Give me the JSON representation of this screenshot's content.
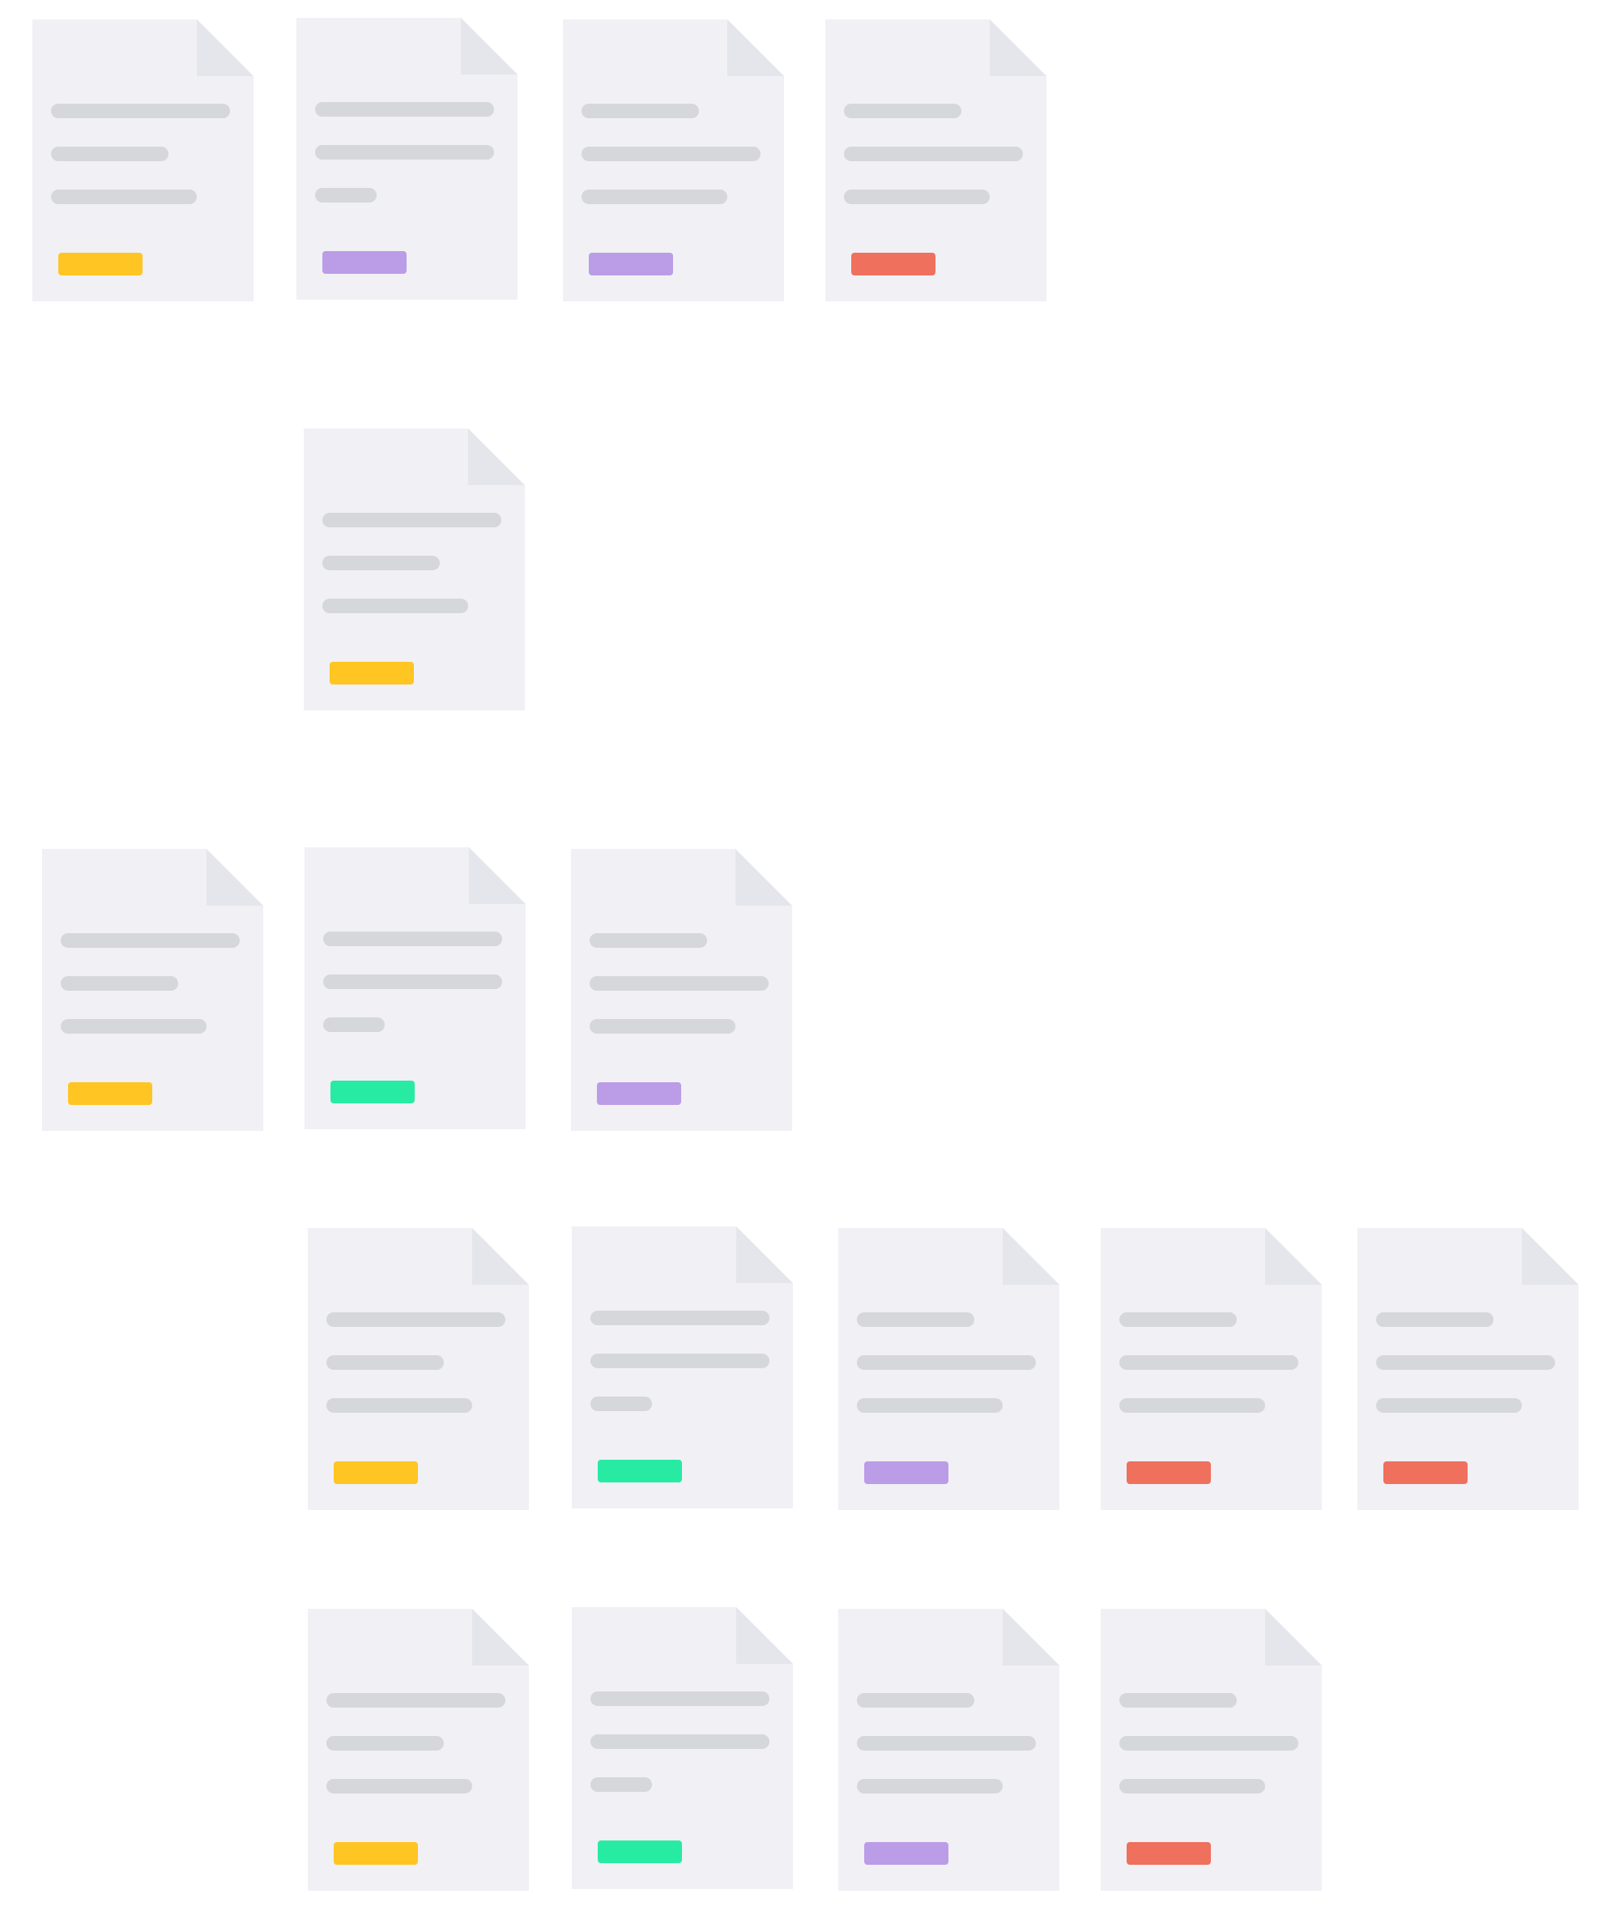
{
  "colors": {
    "page": "#f0f0f5",
    "fold": "#e5e6eb",
    "text_line": "#d6d7db",
    "background": "#ffffff"
  },
  "tag_colors": {
    "yellow": "#ffc522",
    "purple": "#bb9ce6",
    "red": "#ef705d",
    "green": "#28eba3"
  },
  "groups": [
    {
      "name": "group-1",
      "documents": [
        {
          "lines": [
            "long",
            "short",
            "medium"
          ],
          "tag": "yellow"
        },
        {
          "lines": [
            "long",
            "long",
            "tiny"
          ],
          "tag": "purple"
        },
        {
          "lines": [
            "short",
            "long",
            "medium"
          ],
          "tag": "purple"
        },
        {
          "lines": [
            "short",
            "long",
            "medium"
          ],
          "tag": "red"
        }
      ]
    },
    {
      "name": "group-2",
      "documents": [
        {
          "lines": [
            "long",
            "short",
            "medium"
          ],
          "tag": "yellow"
        }
      ]
    },
    {
      "name": "group-3",
      "documents": [
        {
          "lines": [
            "long",
            "short",
            "medium"
          ],
          "tag": "yellow"
        },
        {
          "lines": [
            "long",
            "long",
            "tiny"
          ],
          "tag": "green"
        },
        {
          "lines": [
            "short",
            "long",
            "medium"
          ],
          "tag": "purple"
        }
      ]
    },
    {
      "name": "group-4",
      "documents": [
        {
          "lines": [
            "long",
            "short",
            "medium"
          ],
          "tag": "yellow"
        },
        {
          "lines": [
            "long",
            "long",
            "tiny"
          ],
          "tag": "green"
        },
        {
          "lines": [
            "short",
            "long",
            "medium"
          ],
          "tag": "purple"
        },
        {
          "lines": [
            "short",
            "long",
            "medium"
          ],
          "tag": "red"
        },
        {
          "lines": [
            "short",
            "long",
            "medium"
          ],
          "tag": "red"
        }
      ]
    },
    {
      "name": "group-5",
      "documents": [
        {
          "lines": [
            "long",
            "short",
            "medium"
          ],
          "tag": "yellow"
        },
        {
          "lines": [
            "long",
            "long",
            "tiny"
          ],
          "tag": "green"
        },
        {
          "lines": [
            "short",
            "long",
            "medium"
          ],
          "tag": "purple"
        },
        {
          "lines": [
            "short",
            "long",
            "medium"
          ],
          "tag": "red"
        }
      ]
    }
  ]
}
